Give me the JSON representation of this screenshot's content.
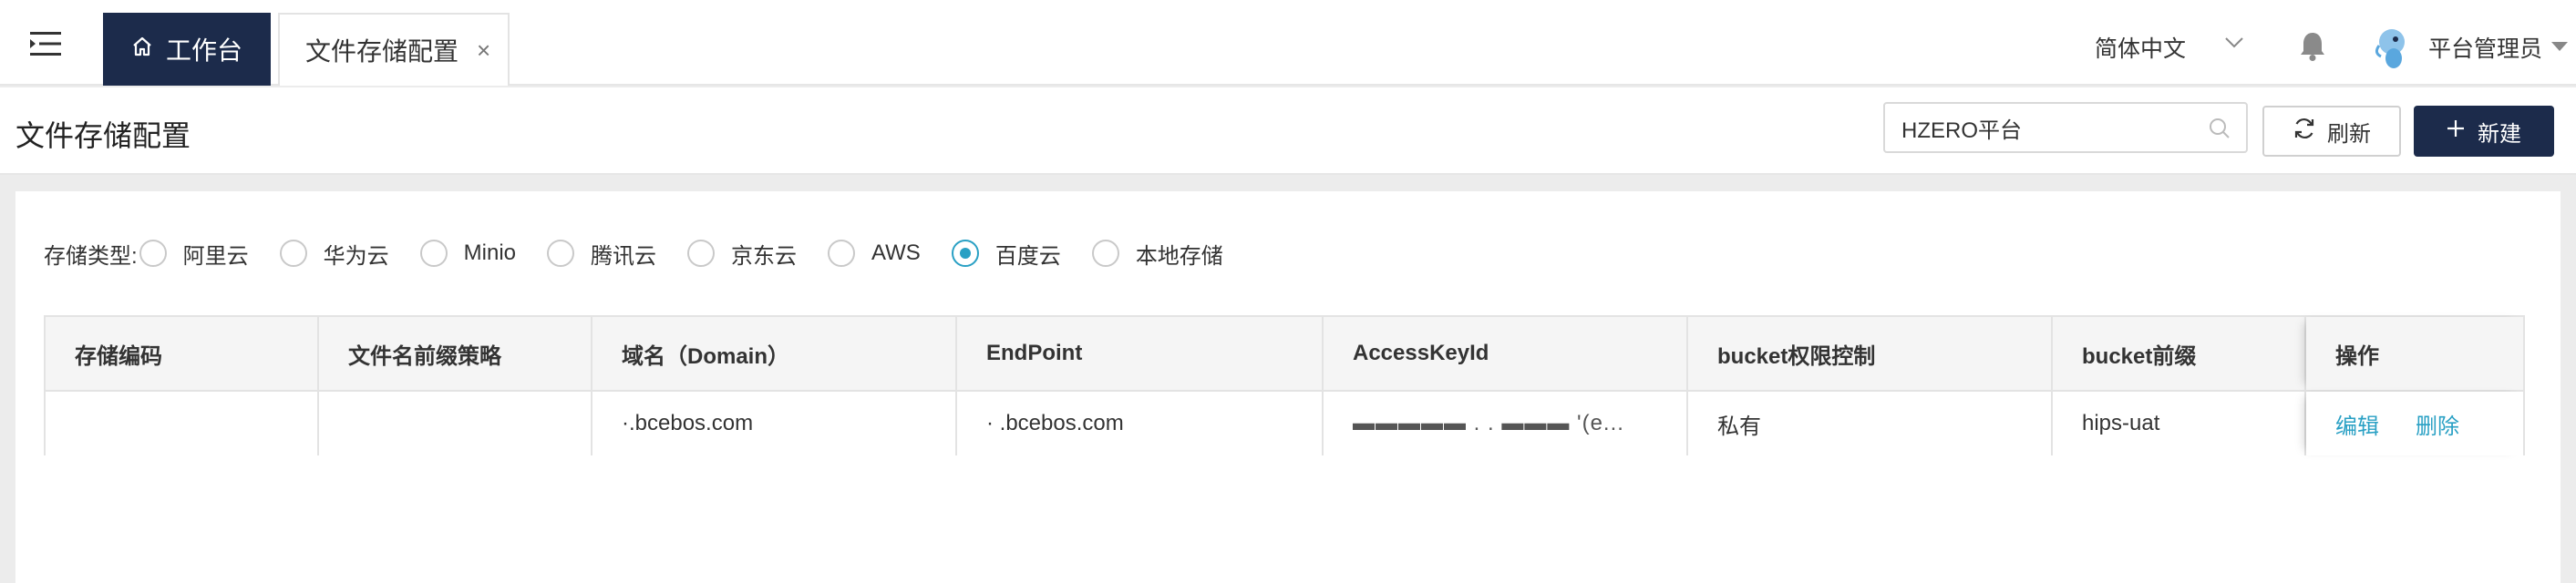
{
  "topbar": {
    "menu_icon": "menu-fold-icon",
    "tabs": [
      {
        "label": "工作台",
        "icon": "home-icon"
      },
      {
        "label": "文件存储配置",
        "close": "×"
      }
    ],
    "language": "简体中文",
    "user_name": "平台管理员"
  },
  "page": {
    "title": "文件存储配置",
    "tenant_value": "HZERO平台",
    "refresh_label": "刷新",
    "new_label": "新建"
  },
  "storage_type": {
    "label": "存储类型:",
    "options": [
      "阿里云",
      "华为云",
      "Minio",
      "腾讯云",
      "京东云",
      "AWS",
      "百度云",
      "本地存储"
    ],
    "selected": "百度云"
  },
  "table": {
    "columns": [
      "存储编码",
      "文件名前缀策略",
      "域名（Domain）",
      "EndPoint",
      "AccessKeyId",
      "bucket权限控制",
      "bucket前缀",
      "操作"
    ],
    "rows": [
      {
        "code": "",
        "prefix_strategy": "",
        "domain": "·.bcebos.com",
        "endpoint": "·  .bcebos.com",
        "access_key": "▬▬▬▬▬ . . ▬▬▬ '(e...",
        "bucket_acl": "私有",
        "bucket_prefix": "hips-uat",
        "actions": [
          "编辑",
          "删除"
        ]
      }
    ]
  },
  "colors": {
    "primary_dark": "#1c2b4b",
    "link": "#29a0c4"
  }
}
